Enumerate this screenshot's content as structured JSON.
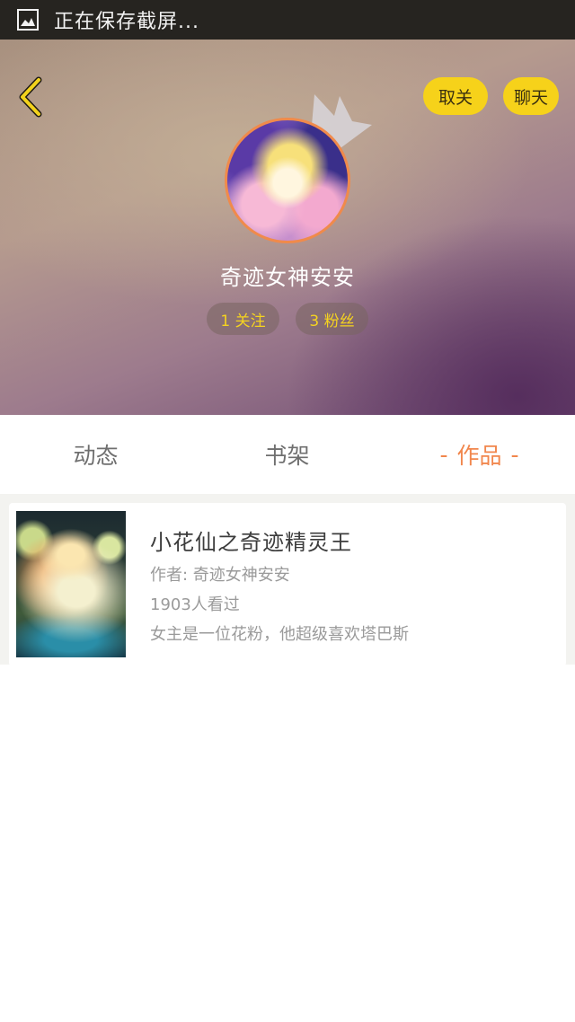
{
  "status_bar": {
    "icon": "screenshot-icon",
    "text": "正在保存截屏..."
  },
  "header": {
    "back_icon": "chevron-left-icon",
    "unfollow_label": "取关",
    "chat_label": "聊天",
    "crown_icon": "crown-icon",
    "username": "奇迹女神安安",
    "follow_count": "1 关注",
    "fan_count": "3 粉丝"
  },
  "tabs": {
    "items": [
      "动态",
      "书架",
      "作品"
    ],
    "active": "作品",
    "dash": "-"
  },
  "works": [
    {
      "title": "小花仙之奇迹精灵王",
      "author": "作者: 奇迹女神安安",
      "views": "1903人看过",
      "description": "女主是一位花粉，他超级喜欢塔巴斯"
    }
  ],
  "colors": {
    "accent": "#f1864c",
    "button_yellow": "#f6d21a",
    "badge_text": "#f5d320"
  }
}
